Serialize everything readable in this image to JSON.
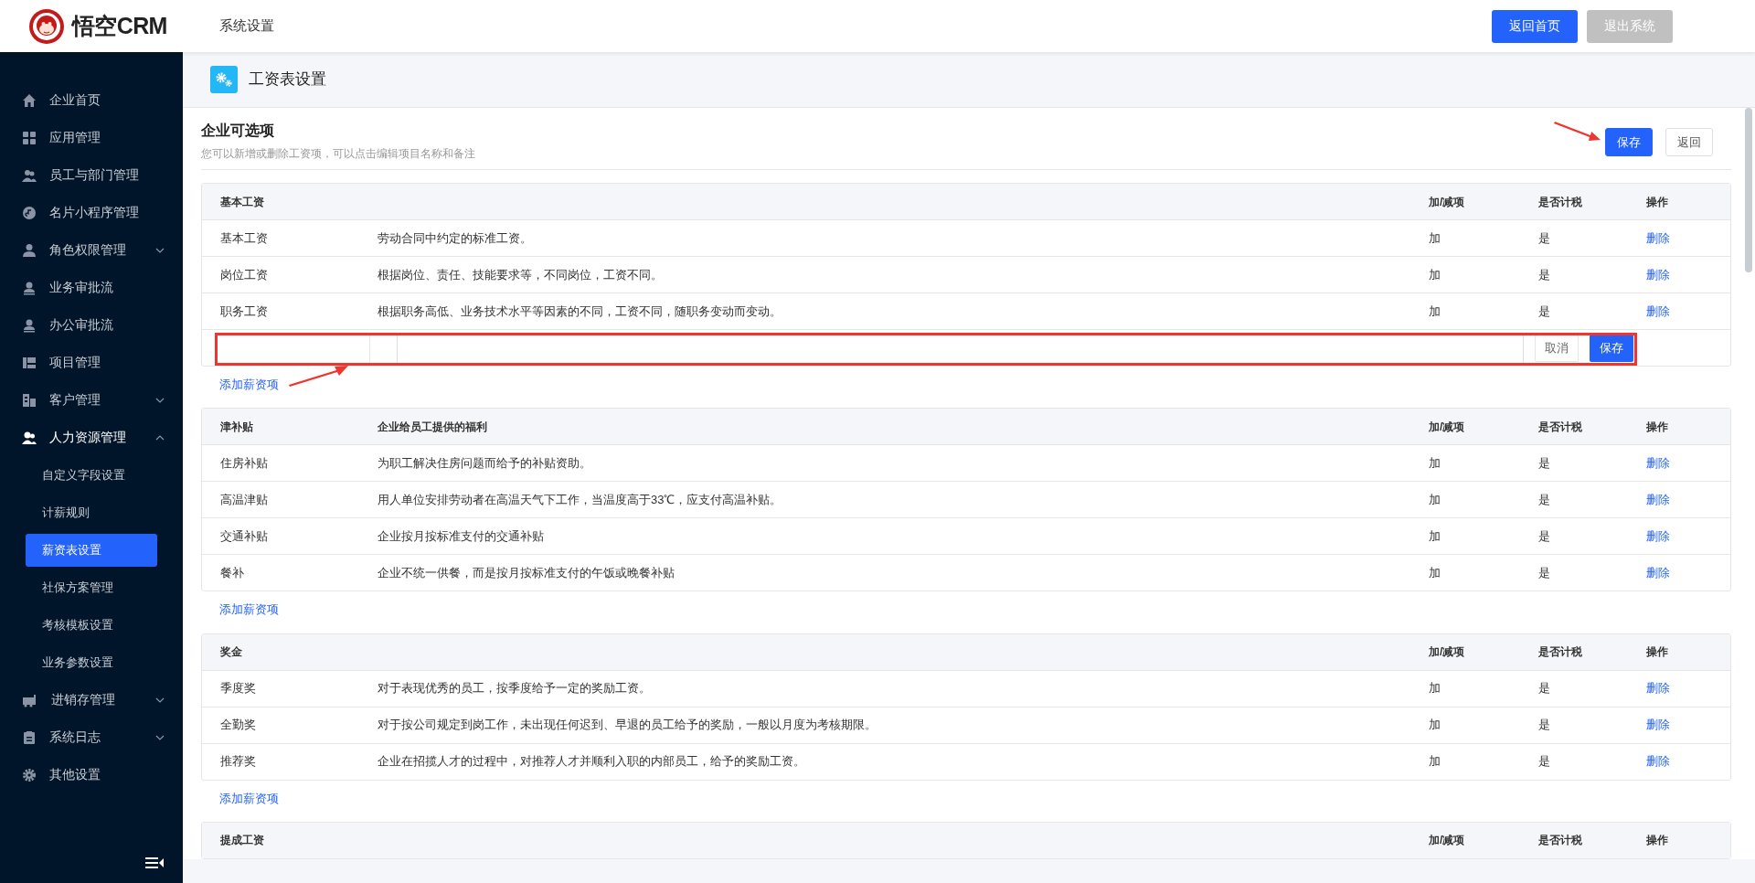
{
  "header": {
    "logo_text": "悟空CRM",
    "section": "系统设置",
    "buttons": [
      {
        "label": "返回首页",
        "kind": "primary"
      },
      {
        "label": "退出系统",
        "kind": "muted"
      }
    ]
  },
  "sidebar": {
    "items": [
      {
        "label": "企业首页",
        "kind": "link",
        "selected": false
      },
      {
        "label": "应用管理",
        "kind": "link",
        "selected": false
      },
      {
        "label": "员工与部门管理",
        "kind": "link",
        "selected": false
      },
      {
        "label": "名片小程序管理",
        "kind": "link",
        "selected": false
      },
      {
        "label": "角色权限管理",
        "kind": "group",
        "selected": false,
        "expanded": false
      },
      {
        "label": "业务审批流",
        "kind": "link",
        "selected": false
      },
      {
        "label": "办公审批流",
        "kind": "link",
        "selected": false
      },
      {
        "label": "项目管理",
        "kind": "link",
        "selected": false
      },
      {
        "label": "客户管理",
        "kind": "group",
        "selected": false,
        "expanded": false
      },
      {
        "label": "人力资源管理",
        "kind": "group",
        "selected": false,
        "expanded": true,
        "children": [
          {
            "label": "自定义字段设置",
            "selected": false
          },
          {
            "label": "计薪规则",
            "selected": false
          },
          {
            "label": "薪资表设置",
            "selected": true
          },
          {
            "label": "社保方案管理",
            "selected": false
          },
          {
            "label": "考核模板设置",
            "selected": false
          },
          {
            "label": "业务参数设置",
            "selected": false
          }
        ]
      },
      {
        "label": "进销存管理",
        "kind": "group",
        "selected": false,
        "expanded": false
      },
      {
        "label": "系统日志",
        "kind": "group",
        "selected": false,
        "expanded": false
      },
      {
        "label": "其他设置",
        "kind": "link",
        "selected": false
      }
    ]
  },
  "page": {
    "title": "工资表设置",
    "section_title": "企业可选项",
    "section_hint": "您可以新增或删除工资项，可以点击编辑项目名称和备注",
    "buttons": [
      {
        "label": "保存",
        "kind": "primary"
      },
      {
        "label": "返回",
        "kind": "plain"
      }
    ]
  },
  "groups": [
    {
      "header": {
        "name": "基本工资",
        "add_sub": "加/减项",
        "taxable": "是否计税",
        "action": "操作"
      },
      "rows": [
        {
          "name": "基本工资",
          "description": "劳动合同中约定的标准工资。",
          "add_sub": "加",
          "taxable": "是",
          "action": "删除"
        },
        {
          "name": "岗位工资",
          "description": "根据岗位、责任、技能要求等，不同岗位，工资不同。",
          "add_sub": "加",
          "taxable": "是",
          "action": "删除"
        },
        {
          "name": "职务工资",
          "description": "根据职务高低、业务技术水平等因素的不同，工资不同，随职务变动而变动。",
          "add_sub": "加",
          "taxable": "是",
          "action": "删除"
        }
      ],
      "editor": {
        "cancel": "取消",
        "save": "保存"
      },
      "add_link": "添加薪资项"
    },
    {
      "header": {
        "name": "津补贴",
        "description": "企业给员工提供的福利",
        "add_sub": "加/减项",
        "taxable": "是否计税",
        "action": "操作"
      },
      "rows": [
        {
          "name": "住房补贴",
          "description": "为职工解决住房问题而给予的补贴资助。",
          "add_sub": "加",
          "taxable": "是",
          "action": "删除"
        },
        {
          "name": "高温津贴",
          "description": "用人单位安排劳动者在高温天气下工作，当温度高于33℃，应支付高温补贴。",
          "add_sub": "加",
          "taxable": "是",
          "action": "删除"
        },
        {
          "name": "交通补贴",
          "description": "企业按月按标准支付的交通补贴",
          "add_sub": "加",
          "taxable": "是",
          "action": "删除"
        },
        {
          "name": "餐补",
          "description": "企业不统一供餐，而是按月按标准支付的午饭或晚餐补贴",
          "add_sub": "加",
          "taxable": "是",
          "action": "删除"
        }
      ],
      "add_link": "添加薪资项"
    },
    {
      "header": {
        "name": "奖金",
        "add_sub": "加/减项",
        "taxable": "是否计税",
        "action": "操作"
      },
      "rows": [
        {
          "name": "季度奖",
          "description": "对于表现优秀的员工，按季度给予一定的奖励工资。",
          "add_sub": "加",
          "taxable": "是",
          "action": "删除"
        },
        {
          "name": "全勤奖",
          "description": "对于按公司规定到岗工作，未出现任何迟到、早退的员工给予的奖励，一般以月度为考核期限。",
          "add_sub": "加",
          "taxable": "是",
          "action": "删除"
        },
        {
          "name": "推荐奖",
          "description": "企业在招揽人才的过程中，对推荐人才并顺利入职的内部员工，给予的奖励工资。",
          "add_sub": "加",
          "taxable": "是",
          "action": "删除"
        }
      ],
      "add_link": "添加薪资项"
    },
    {
      "header": {
        "name": "提成工资",
        "add_sub": "加/减项",
        "taxable": "是否计税",
        "action": "操作"
      }
    }
  ]
}
